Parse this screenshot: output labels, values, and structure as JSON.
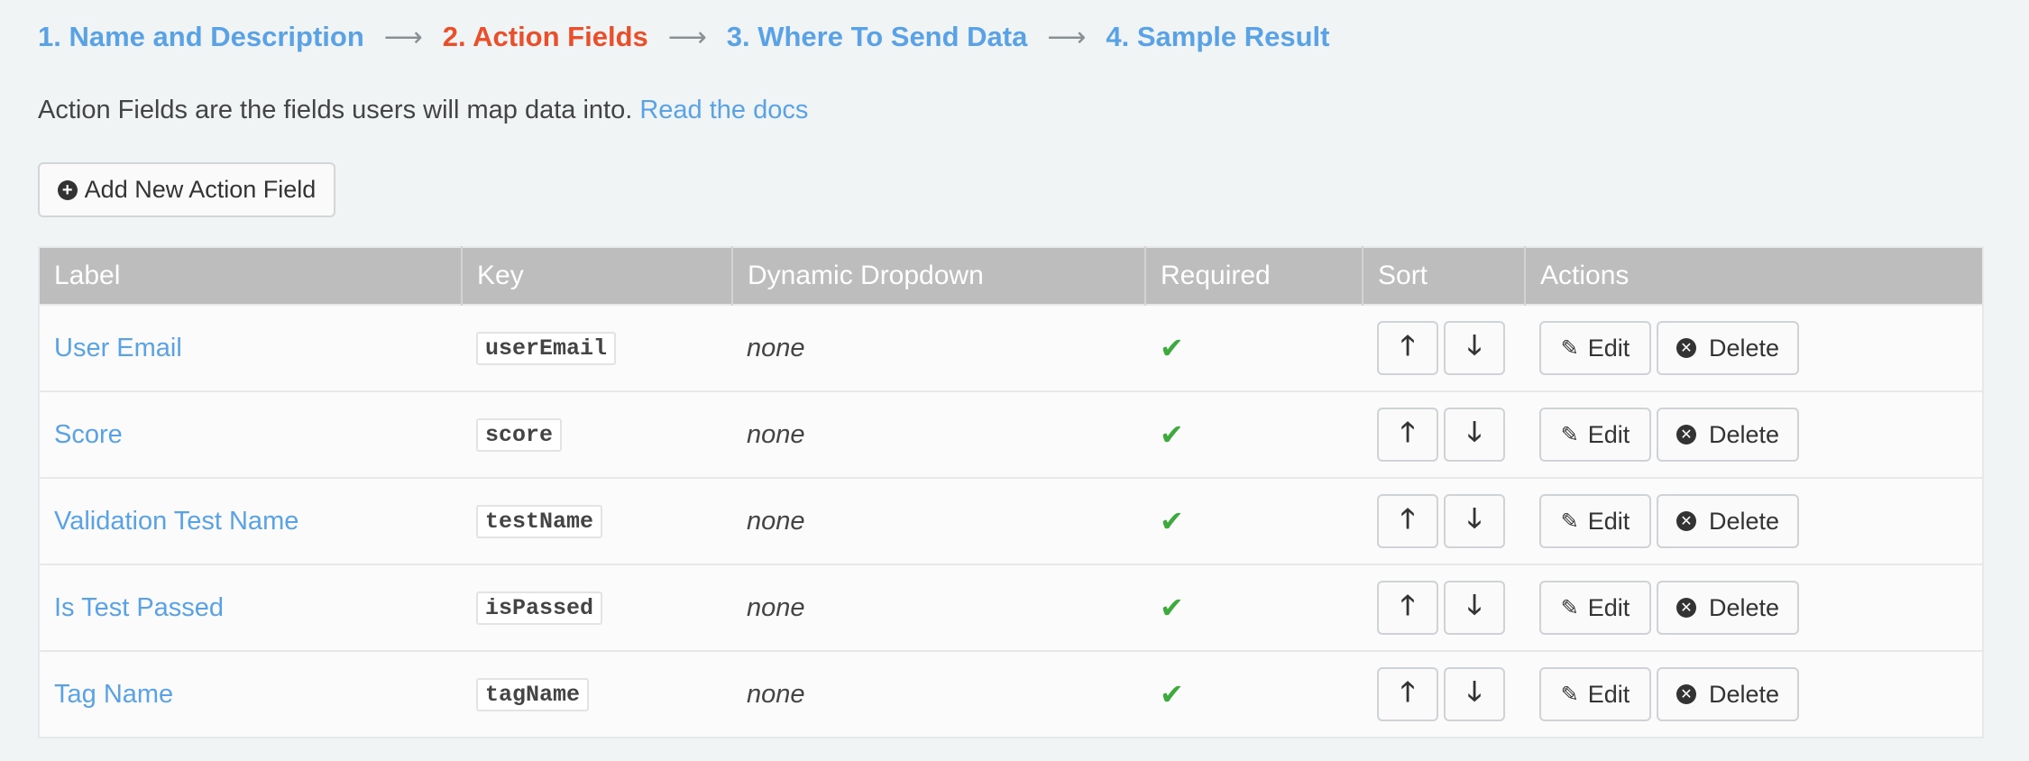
{
  "steps": [
    {
      "label": "1. Name and Description",
      "active": false
    },
    {
      "label": "2. Action Fields",
      "active": true
    },
    {
      "label": "3. Where To Send Data",
      "active": false
    },
    {
      "label": "4. Sample Result",
      "active": false
    }
  ],
  "step_arrow": "⟶",
  "intro": {
    "text": "Action Fields are the fields users will map data into.",
    "link": "Read the docs"
  },
  "add_button": {
    "label": "Add New Action Field",
    "icon": "plus-circle-icon"
  },
  "table": {
    "headers": [
      "Label",
      "Key",
      "Dynamic Dropdown",
      "Required",
      "Sort",
      "Actions"
    ],
    "rows": [
      {
        "label": "User Email",
        "key": "userEmail",
        "dropdown": "none",
        "required": "✔"
      },
      {
        "label": "Score",
        "key": "score",
        "dropdown": "none",
        "required": "✔"
      },
      {
        "label": "Validation Test Name",
        "key": "testName",
        "dropdown": "none",
        "required": "✔"
      },
      {
        "label": "Is Test Passed",
        "key": "isPassed",
        "dropdown": "none",
        "required": "✔"
      },
      {
        "label": "Tag Name",
        "key": "tagName",
        "dropdown": "none",
        "required": "✔"
      }
    ],
    "sort_up": "🡑",
    "sort_down": "🡓",
    "edit_label": "Edit",
    "delete_label": "Delete"
  },
  "colors": {
    "link": "#5aa2e6",
    "active_step": "#ea4f2c",
    "header_bg": "#bdbdbd",
    "check": "#3eaa3e"
  }
}
